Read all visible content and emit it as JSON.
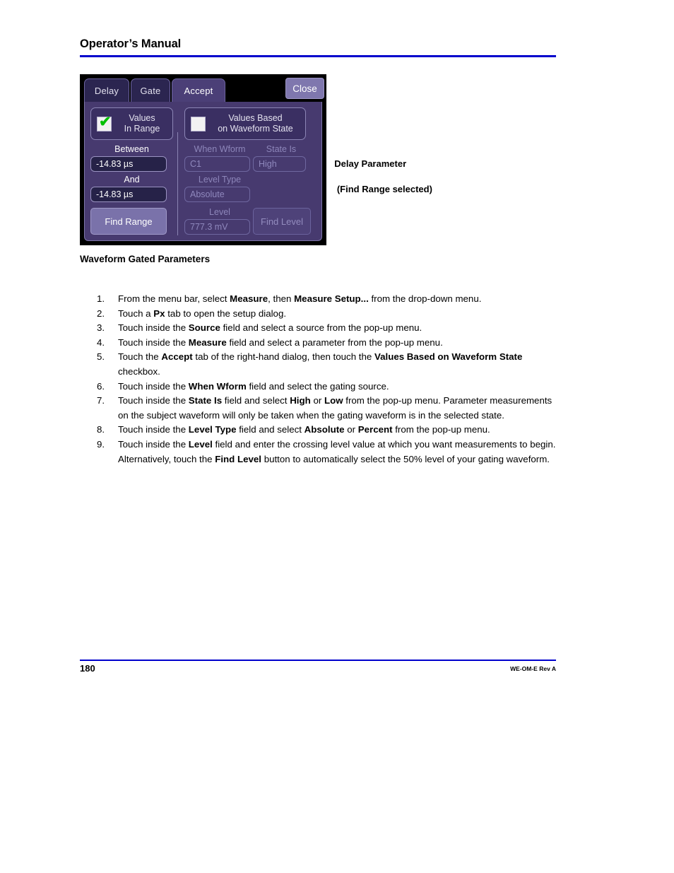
{
  "header": {
    "title": "Operator’s Manual",
    "rule_color": "#0000cc"
  },
  "figure": {
    "caption_line1": "Delay Parameter",
    "caption_line2": " (Find Range selected)",
    "dialog": {
      "tabs": [
        {
          "label": "Delay",
          "active": false
        },
        {
          "label": "Gate",
          "active": false
        },
        {
          "label": "Accept",
          "active": true
        }
      ],
      "close_label": "Close",
      "left_panel": {
        "checkbox": {
          "label_line1": "Values",
          "label_line2": "In Range",
          "checked": true,
          "tick": "✔"
        },
        "between_label": "Between",
        "between_value": "-14.83 µs",
        "and_label": "And",
        "and_value": "-14.83 µs",
        "find_range_label": "Find Range"
      },
      "right_panel": {
        "checkbox": {
          "label_line1": "Values Based",
          "label_line2": "on Waveform State",
          "checked": false
        },
        "when_wform_label": "When Wform",
        "when_wform_value": "C1",
        "state_is_label": "State Is",
        "state_is_value": "High",
        "level_type_label": "Level Type",
        "level_type_value": "Absolute",
        "level_label": "Level",
        "level_value": "777.3 mV",
        "find_level_label": "Find Level"
      },
      "colors": {
        "window_bg": "#000000",
        "body_bg": "#473a6f",
        "tab_inactive": "#2b2550",
        "tab_active": "#4b3f77",
        "field_bg": "#262248",
        "button_bg": "#7a72aa",
        "check_green": "#00c000"
      }
    }
  },
  "section": {
    "heading": "Waveform Gated Parameters"
  },
  "steps": [
    {
      "num": "1.",
      "html": "From the menu bar, select <b>Measure</b>, then <b>Measure Setup...</b> from the drop-down menu."
    },
    {
      "num": "2.",
      "html": "Touch a <b>Px</b> tab to open the setup dialog."
    },
    {
      "num": "3.",
      "html": "Touch inside the <b>Source</b> field and select a source from the pop-up menu."
    },
    {
      "num": "4.",
      "html": "Touch inside the <b>Measure</b> field and select a parameter from the pop-up menu."
    },
    {
      "num": "5.",
      "html": "Touch the <b>Accept</b> tab of the right-hand dialog, then touch the <b>Values Based on Waveform State</b> checkbox."
    },
    {
      "num": "6.",
      "html": "Touch inside the <b>When Wform</b> field and select the gating source."
    },
    {
      "num": "7.",
      "html": "Touch inside the <b>State Is</b> field and select <b>High</b> or <b>Low</b> from the pop-up menu. Parameter measurements on the subject waveform will only be taken when the gating waveform is in the selected state."
    },
    {
      "num": "8.",
      "html": "Touch inside the <b>Level Type</b> field and select <b>Absolute</b> or <b>Percent</b> from the pop-up menu."
    },
    {
      "num": "9.",
      "html": "Touch inside the <b>Level</b> field and enter the crossing level value at which you want measurements to begin. Alternatively, touch the <b>Find Level</b> button to automatically select the 50% level of your gating waveform."
    }
  ],
  "footer": {
    "page_number": "180",
    "doc_id": "WE-OM-E Rev A"
  }
}
